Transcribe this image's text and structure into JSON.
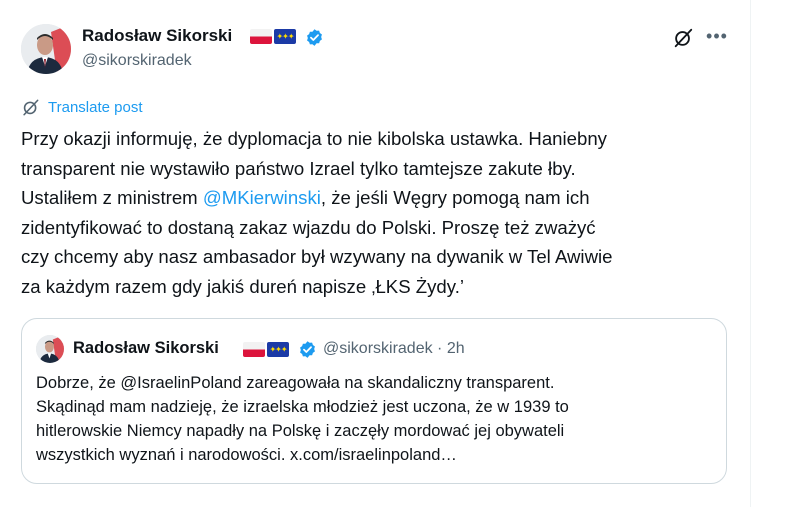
{
  "author": {
    "name": "Radosław Sikorski",
    "handle": "@sikorskiradek",
    "flags": [
      "flag-poland-icon",
      "flag-eu-icon"
    ]
  },
  "translate_label": "Translate post",
  "post": {
    "lines": [
      "Przy okazji informuję, że dyplomacja to nie kibolska ustawka. Haniebny",
      "transparent nie wystawiło państwo Izrael tylko tamtejsze zakute łby.",
      {
        "before": "Ustaliłem  z ministrem ",
        "mention": "@MKierwinski",
        "after": ", że jeśli Węgry pomogą nam ich"
      },
      "zidentyfikować to dostaną zakaz wjazdu do Polski.  Proszę też zważyć",
      "czy chcemy aby nasz ambasador był wzywany na dywanik w Tel Awiwie",
      "za każdym razem gdy jakiś dureń napisze ‚ŁKS Żydy.’"
    ]
  },
  "quoted": {
    "name": "Radosław Sikorski",
    "meta": "@sikorskiradek · 2h",
    "lines": [
      "Dobrze, że @IsraelinPoland zareagowała na skandaliczny transparent.",
      "Skądinąd mam nadzieję, że izraelska młodzież jest uczona, że w 1939 to",
      "hitlerowskie Niemcy napadły na Polskę i zaczęły mordować jej obywateli",
      "wszystkich wyznań i narodowości. x.com/israelinpoland…"
    ]
  },
  "icons": {
    "grok": "grok-icon",
    "more": "more-icon",
    "translate": "translate-icon",
    "verified": "verified-badge-icon"
  },
  "colors": {
    "link": "#1d9bf0",
    "secondary_text": "#536471",
    "border": "#cfd9de",
    "verified": "#1d9bf0"
  }
}
